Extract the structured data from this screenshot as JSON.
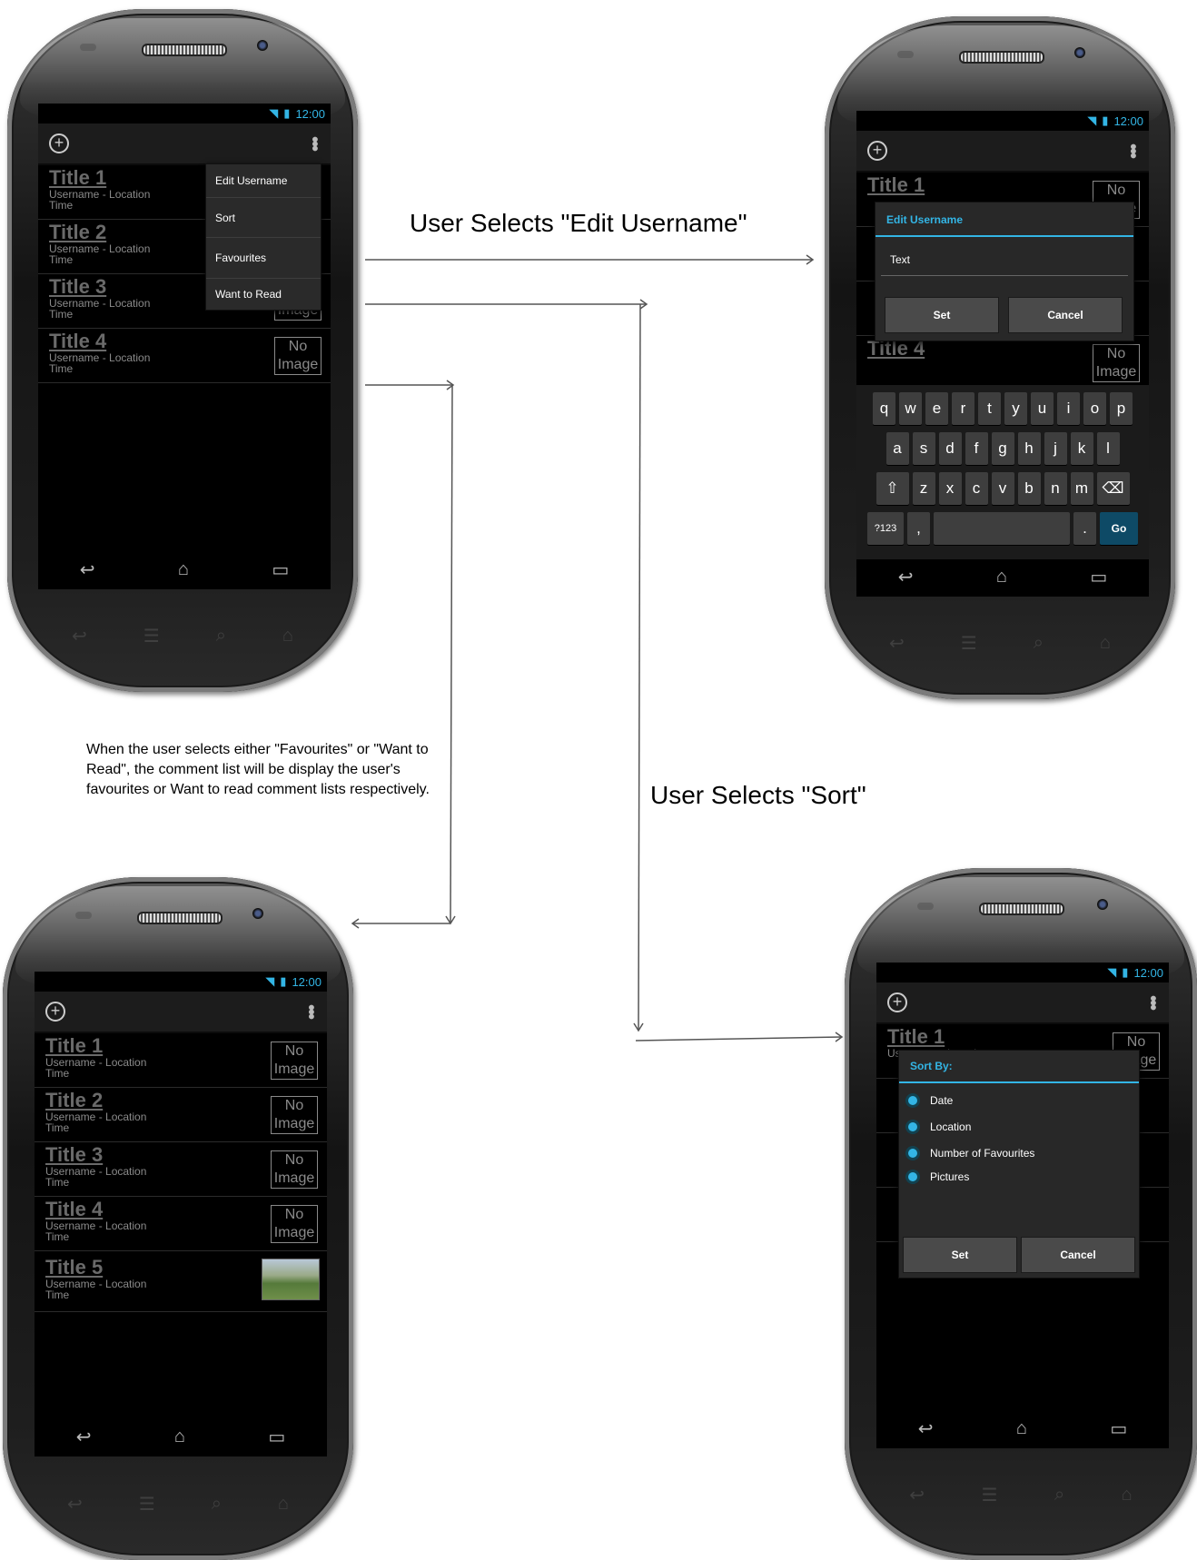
{
  "status": {
    "time": "12:00",
    "wifi_icon": "wifi-icon",
    "signal_icon": "signal-icon",
    "battery_icon": "battery-icon"
  },
  "actionbar": {
    "add_icon": "add-circle-icon",
    "overflow_icon": "overflow-menu-icon"
  },
  "list_items": [
    {
      "title": "Title 1",
      "line1": "Username - Location",
      "line2": "Time",
      "image": "No Image"
    },
    {
      "title": "Title 2",
      "line1": "Username - Location",
      "line2": "Time",
      "image": "No Image"
    },
    {
      "title": "Title 3",
      "line1": "Username - Location",
      "line2": "Time",
      "image": "No Image"
    },
    {
      "title": "Title 4",
      "line1": "Username - Location",
      "line2": "Time",
      "image": "No Image"
    },
    {
      "title": "Title 5",
      "line1": "Username - Location",
      "line2": "Time"
    }
  ],
  "no_image": {
    "line1": "No",
    "line2": "Image"
  },
  "menu": [
    "Edit Username",
    "Sort",
    "Favourites",
    "Want to Read"
  ],
  "edit_dialog": {
    "title": "Edit Username",
    "field": "Text",
    "set": "Set",
    "cancel": "Cancel"
  },
  "sort_dialog": {
    "title": "Sort By:",
    "options": [
      "Date",
      "Location",
      "Number of Favourites",
      "Pictures"
    ],
    "set": "Set",
    "cancel": "Cancel"
  },
  "keyboard": {
    "row1": [
      "q",
      "w",
      "e",
      "r",
      "t",
      "y",
      "u",
      "i",
      "o",
      "p"
    ],
    "row2": [
      "a",
      "s",
      "d",
      "f",
      "g",
      "h",
      "j",
      "k",
      "l"
    ],
    "row3": [
      "z",
      "x",
      "c",
      "v",
      "b",
      "n",
      "m"
    ],
    "sym": "?123",
    "comma": ",",
    "period": ".",
    "go": "Go"
  },
  "annotations": {
    "edit_label": "User Selects \"Edit Username\"",
    "sort_label": "User Selects \"Sort\"",
    "note": "When the user selects either \"Favourites\" or \"Want to Read\", the comment list will be display the user's favourites or Want to read comment lists respectively."
  },
  "nav_icons": [
    "back-icon",
    "home-icon",
    "recent-apps-icon"
  ],
  "accent_color": "#33b5e5"
}
